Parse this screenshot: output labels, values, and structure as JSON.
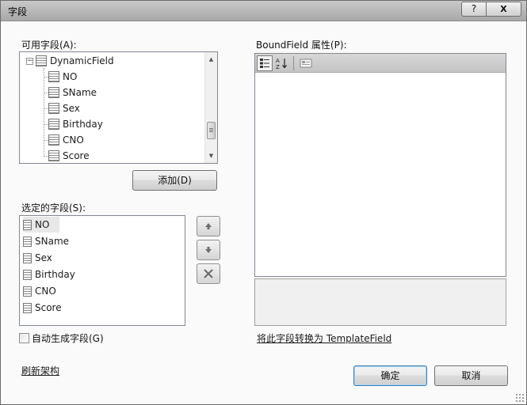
{
  "window": {
    "title": "字段",
    "help_label": "?",
    "close_label": "X"
  },
  "available": {
    "label": "可用字段(A):",
    "root": "DynamicField",
    "items": [
      "NO",
      "SName",
      "Sex",
      "Birthday",
      "CNO",
      "Score"
    ],
    "add_label": "添加(D)"
  },
  "selected": {
    "label": "选定的字段(S):",
    "items": [
      "NO",
      "SName",
      "Sex",
      "Birthday",
      "CNO",
      "Score"
    ]
  },
  "properties": {
    "label": "BoundField 属性(P):",
    "convert_link": "将此字段转换为 TemplateField"
  },
  "autogen_label": "自动生成字段(G)",
  "refresh_link": "刷新架构",
  "ok_label": "确定",
  "cancel_label": "取消",
  "icons": {
    "move_up": "arrow-up-icon",
    "move_down": "arrow-down-icon",
    "delete": "delete-x-icon",
    "categorized": "categorized-icon",
    "alphabetical": "alphabetical-sort-icon",
    "property_pages": "property-pages-icon"
  }
}
